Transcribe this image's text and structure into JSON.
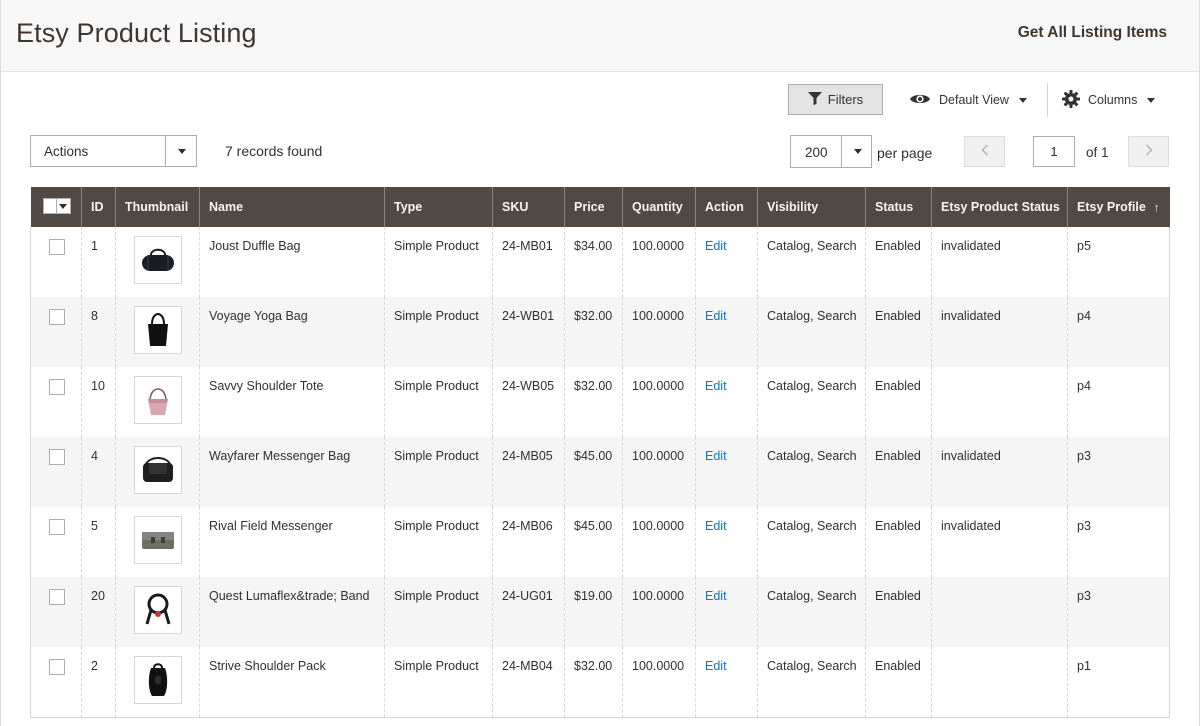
{
  "header": {
    "title": "Etsy Product Listing",
    "action_label": "Get All Listing Items"
  },
  "toolbar": {
    "filters_label": "Filters",
    "view_label": "Default View",
    "columns_label": "Columns",
    "actions_label": "Actions",
    "records_found": "7 records found",
    "per_page_value": "200",
    "per_page_label": "per page",
    "page_current": "1",
    "page_of": "of 1"
  },
  "grid": {
    "columns": [
      "ID",
      "Thumbnail",
      "Name",
      "Type",
      "SKU",
      "Price",
      "Quantity",
      "Action",
      "Visibility",
      "Status",
      "Etsy Product Status",
      "Etsy Profile"
    ],
    "sort_indicator": "↑",
    "rows": [
      {
        "id": "1",
        "thumb": "duffle-bag",
        "name": "Joust Duffle Bag",
        "type": "Simple Product",
        "sku": "24-MB01",
        "price": "$34.00",
        "qty": "100.0000",
        "action": "Edit",
        "visibility": "Catalog, Search",
        "status": "Enabled",
        "etsy_status": "invalidated",
        "profile": "p5"
      },
      {
        "id": "8",
        "thumb": "tote-bag",
        "name": "Voyage Yoga Bag",
        "type": "Simple Product",
        "sku": "24-WB01",
        "price": "$32.00",
        "qty": "100.0000",
        "action": "Edit",
        "visibility": "Catalog, Search",
        "status": "Enabled",
        "etsy_status": "invalidated",
        "profile": "p4"
      },
      {
        "id": "10",
        "thumb": "shoulder-tote",
        "name": "Savvy Shoulder Tote",
        "type": "Simple Product",
        "sku": "24-WB05",
        "price": "$32.00",
        "qty": "100.0000",
        "action": "Edit",
        "visibility": "Catalog, Search",
        "status": "Enabled",
        "etsy_status": "",
        "profile": "p4"
      },
      {
        "id": "4",
        "thumb": "messenger-bag",
        "name": "Wayfarer Messenger Bag",
        "type": "Simple Product",
        "sku": "24-MB05",
        "price": "$45.00",
        "qty": "100.0000",
        "action": "Edit",
        "visibility": "Catalog, Search",
        "status": "Enabled",
        "etsy_status": "invalidated",
        "profile": "p3"
      },
      {
        "id": "5",
        "thumb": "field-messenger",
        "name": "Rival Field Messenger",
        "type": "Simple Product",
        "sku": "24-MB06",
        "price": "$45.00",
        "qty": "100.0000",
        "action": "Edit",
        "visibility": "Catalog, Search",
        "status": "Enabled",
        "etsy_status": "invalidated",
        "profile": "p3"
      },
      {
        "id": "20",
        "thumb": "resistance-band",
        "name": "Quest Lumaflex&trade; Band",
        "type": "Simple Product",
        "sku": "24-UG01",
        "price": "$19.00",
        "qty": "100.0000",
        "action": "Edit",
        "visibility": "Catalog, Search",
        "status": "Enabled",
        "etsy_status": "",
        "profile": "p3"
      },
      {
        "id": "2",
        "thumb": "backpack",
        "name": "Strive Shoulder Pack",
        "type": "Simple Product",
        "sku": "24-MB04",
        "price": "$32.00",
        "qty": "100.0000",
        "action": "Edit",
        "visibility": "Catalog, Search",
        "status": "Enabled",
        "etsy_status": "",
        "profile": "p1"
      }
    ]
  },
  "colors": {
    "header_bg": "#514943",
    "link": "#007bdb",
    "title": "#41362f",
    "row_alt": "#f5f5f5"
  }
}
